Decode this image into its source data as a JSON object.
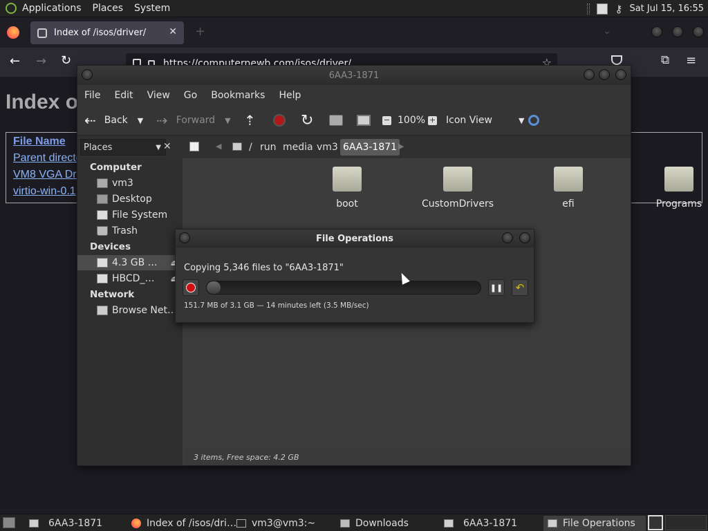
{
  "top_panel": {
    "menus": [
      "Applications",
      "Places",
      "System"
    ],
    "datetime": "Sat Jul 15, 16:55"
  },
  "firefox": {
    "tab_title": "Index of /isos/driver/",
    "url": "https://computernewb.com/isos/driver/",
    "page": {
      "heading": "Index o",
      "column_header": "File Name",
      "rows": [
        "Parent directo",
        "VM8 VGA Dri",
        "virtio-win-0.1"
      ]
    }
  },
  "caja": {
    "title": "6AA3-1871",
    "menu": [
      "File",
      "Edit",
      "View",
      "Go",
      "Bookmarks",
      "Help"
    ],
    "toolbar": {
      "back": "Back",
      "forward": "Forward",
      "zoom": "100%",
      "view_mode": "Icon View"
    },
    "places_label": "Places",
    "path": [
      "/",
      "run",
      "media",
      "vm3",
      "6AA3-1871"
    ],
    "sidebar": {
      "computer_head": "Computer",
      "computer_items": [
        "vm3",
        "Desktop",
        "File System",
        "Trash"
      ],
      "devices_head": "Devices",
      "devices_items": [
        "4.3 GB …",
        "HBCD_…"
      ],
      "network_head": "Network",
      "network_items": [
        "Browse Net…"
      ]
    },
    "files": [
      "boot",
      "CustomDrivers",
      "efi",
      "Programs"
    ],
    "status": "3 items, Free space: 4.2 GB"
  },
  "file_operations": {
    "title": "File Operations",
    "message": "Copying 5,346 files to \"6AA3-1871\"",
    "detail": "151.7 MB of 3.1 GB — 14 minutes left (3.5 MB/sec)",
    "progress_fraction": 0.05
  },
  "taskbar": {
    "tasks": [
      "6AA3-1871",
      "Index of /isos/dri…",
      "vm3@vm3:~",
      "Downloads",
      "6AA3-1871",
      "File Operations"
    ]
  },
  "colors": {
    "link": "#8ab4f8",
    "record_red": "#d01010",
    "undo_yellow": "#d8c000"
  }
}
